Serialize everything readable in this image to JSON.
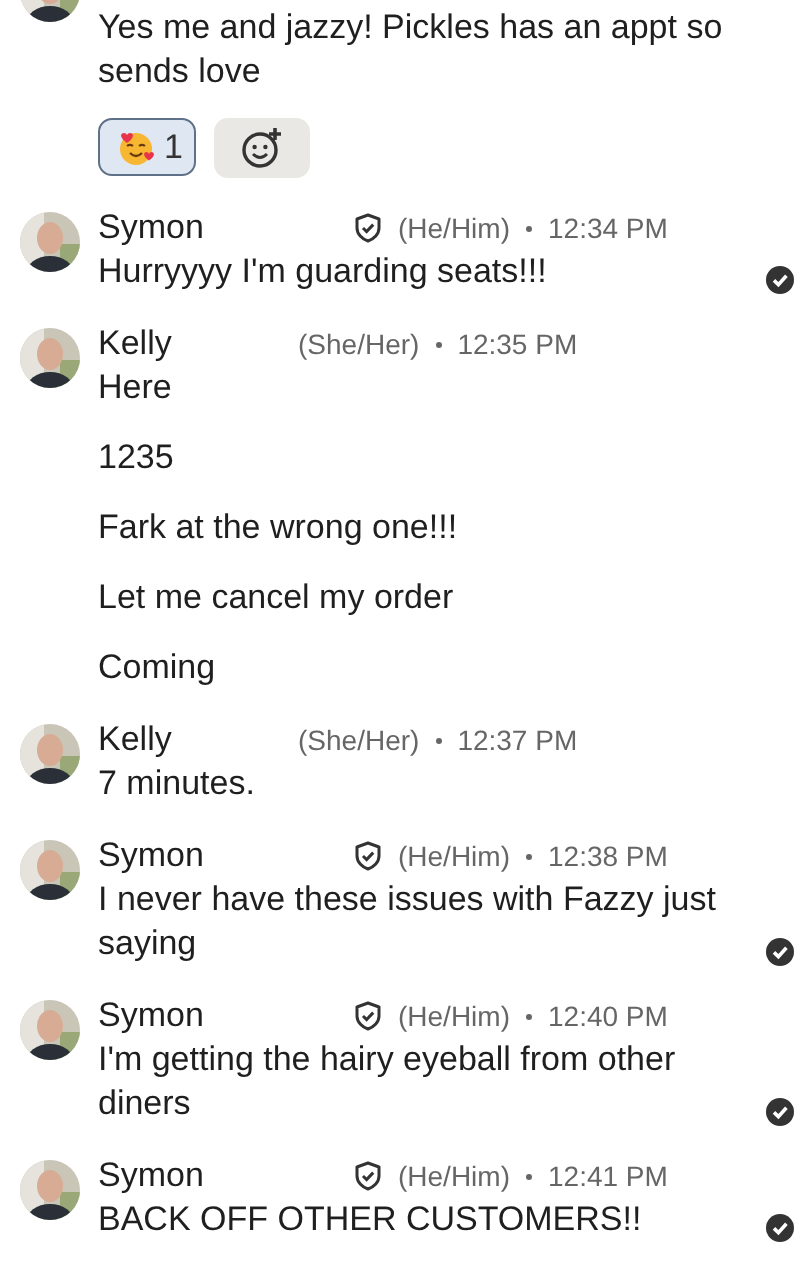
{
  "messages": [
    {
      "kind": "continuation",
      "paragraphs": [
        "Yes me and jazzy! Pickles has an appt so sends love"
      ],
      "read": false,
      "reactions": [
        {
          "count": "1",
          "selected": true
        }
      ],
      "add_reaction": true
    },
    {
      "kind": "message",
      "author": "Symon",
      "verified": true,
      "pronouns": "(He/Him)",
      "time": "12:34 PM",
      "paragraphs": [
        "Hurryyyy I'm guarding seats!!!"
      ],
      "read": true
    },
    {
      "kind": "message",
      "author": "Kelly",
      "verified": false,
      "pronouns": "(She/Her)",
      "time": "12:35 PM",
      "paragraphs": [
        "Here",
        "1235",
        "Fark at the wrong one!!!",
        "Let me cancel my order",
        "Coming"
      ],
      "read": false
    },
    {
      "kind": "message",
      "author": "Kelly",
      "verified": false,
      "pronouns": "(She/Her)",
      "time": "12:37 PM",
      "paragraphs": [
        "7 minutes."
      ],
      "read": false
    },
    {
      "kind": "message",
      "author": "Symon",
      "verified": true,
      "pronouns": "(He/Him)",
      "time": "12:38 PM",
      "paragraphs": [
        "I never have these issues with Fazzy just saying"
      ],
      "read": true
    },
    {
      "kind": "message",
      "author": "Symon",
      "verified": true,
      "pronouns": "(He/Him)",
      "time": "12:40 PM",
      "paragraphs": [
        "I'm getting the hairy eyeball from other diners"
      ],
      "read": true
    },
    {
      "kind": "message",
      "author": "Symon",
      "verified": true,
      "pronouns": "(He/Him)",
      "time": "12:41 PM",
      "paragraphs": [
        "BACK OFF OTHER CUSTOMERS!!"
      ],
      "read": true
    }
  ]
}
